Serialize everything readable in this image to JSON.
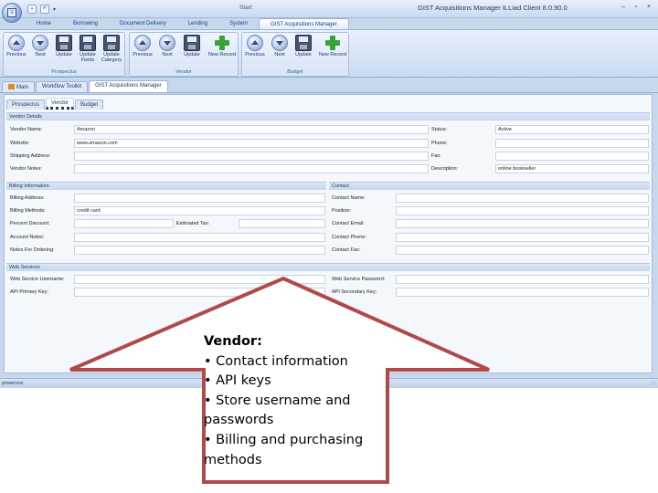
{
  "window": {
    "document_title": "Start",
    "app_title": "GIST Acquisitions Manager ILLiad Client 8.0.90.0",
    "orb_icon": "app-orb-icon",
    "controls": [
      "–",
      "▫",
      "×"
    ]
  },
  "quick_access": [
    "save",
    "undo"
  ],
  "ribbon": {
    "tabs": [
      "Home",
      "Borrowing",
      "Document Delivery",
      "Lending",
      "System",
      "GIST Acquisitions Manager"
    ],
    "active_tab": "GIST Acquisitions Manager",
    "groups": [
      {
        "label": "Prospectus",
        "buttons": [
          {
            "label": "Previous",
            "icon": "arrow-up-icon"
          },
          {
            "label": "Next",
            "icon": "arrow-down-icon"
          },
          {
            "label": "Update",
            "icon": "save-icon"
          },
          {
            "label": "Update Fields",
            "icon": "save-icon"
          },
          {
            "label": "Update Category",
            "icon": "save-icon"
          }
        ]
      },
      {
        "label": "Vendor",
        "buttons": [
          {
            "label": "Previous",
            "icon": "arrow-up-icon"
          },
          {
            "label": "Next",
            "icon": "arrow-down-icon"
          },
          {
            "label": "Update",
            "icon": "save-icon"
          },
          {
            "label": "New Record",
            "icon": "plus-icon"
          }
        ]
      },
      {
        "label": "Budget",
        "buttons": [
          {
            "label": "Previous",
            "icon": "arrow-up-icon"
          },
          {
            "label": "Next",
            "icon": "arrow-down-icon"
          },
          {
            "label": "Update",
            "icon": "save-icon"
          },
          {
            "label": "New Record",
            "icon": "plus-icon"
          }
        ]
      }
    ]
  },
  "doc_tabs": [
    "Main",
    "Workflow Toolkit",
    "GIST Acquisitions Manager"
  ],
  "sub_tabs": [
    "Prospectus",
    "Vendor",
    "Budget"
  ],
  "vendor_details": {
    "title": "Vendor Details",
    "vendor_name_label": "Vendor Name:",
    "vendor_name_value": "Amazon",
    "website_label": "Website:",
    "website_value": "www.amazon.com",
    "shipping_label": "Shipping Address:",
    "shipping_value": "",
    "notes_label": "Vendor Notes:",
    "notes_value": "",
    "status_label": "Status:",
    "status_value": "Active",
    "phone_label": "Phone:",
    "phone_value": "",
    "fax_label": "Fax:",
    "fax_value": "",
    "description_label": "Description:",
    "description_value": "online bookseller"
  },
  "billing": {
    "title": "Billing Information",
    "address_label": "Billing Address:",
    "address_value": "",
    "methods_label": "Billing Methods:",
    "methods_value": "credit card",
    "discount_label": "Percent Discount:",
    "discount_value": "",
    "estimated_tax_label": "Estimated Tax:",
    "estimated_tax_value": "",
    "account_notes_label": "Account Notes:",
    "account_notes_value": "",
    "ordering_notes_label": "Notes For Ordering:",
    "ordering_notes_value": ""
  },
  "contact": {
    "title": "Contact",
    "name_label": "Contact Name:",
    "name_value": "",
    "position_label": "Position:",
    "position_value": "",
    "email_label": "Contact Email:",
    "email_value": "",
    "phone_label": "Contact Phone:",
    "phone_value": "",
    "fax_label": "Contact Fax:",
    "fax_value": ""
  },
  "web_services": {
    "title": "Web Services",
    "username_label": "Web Service Username:",
    "username_value": "",
    "password_label": "Web Service Password:",
    "password_value": "",
    "primary_key_label": "API Primary Key:",
    "primary_key_value": "",
    "secondary_key_label": "API Secondary Key:",
    "secondary_key_value": ""
  },
  "status_bar": {
    "text": "powersox",
    "grip": "::::"
  },
  "callout": {
    "title": "Vendor:",
    "lines": [
      "• Contact information",
      "• API keys",
      "• Store username and passwords",
      "• Billing and purchasing methods"
    ],
    "stroke_color": "#b04a4a"
  }
}
